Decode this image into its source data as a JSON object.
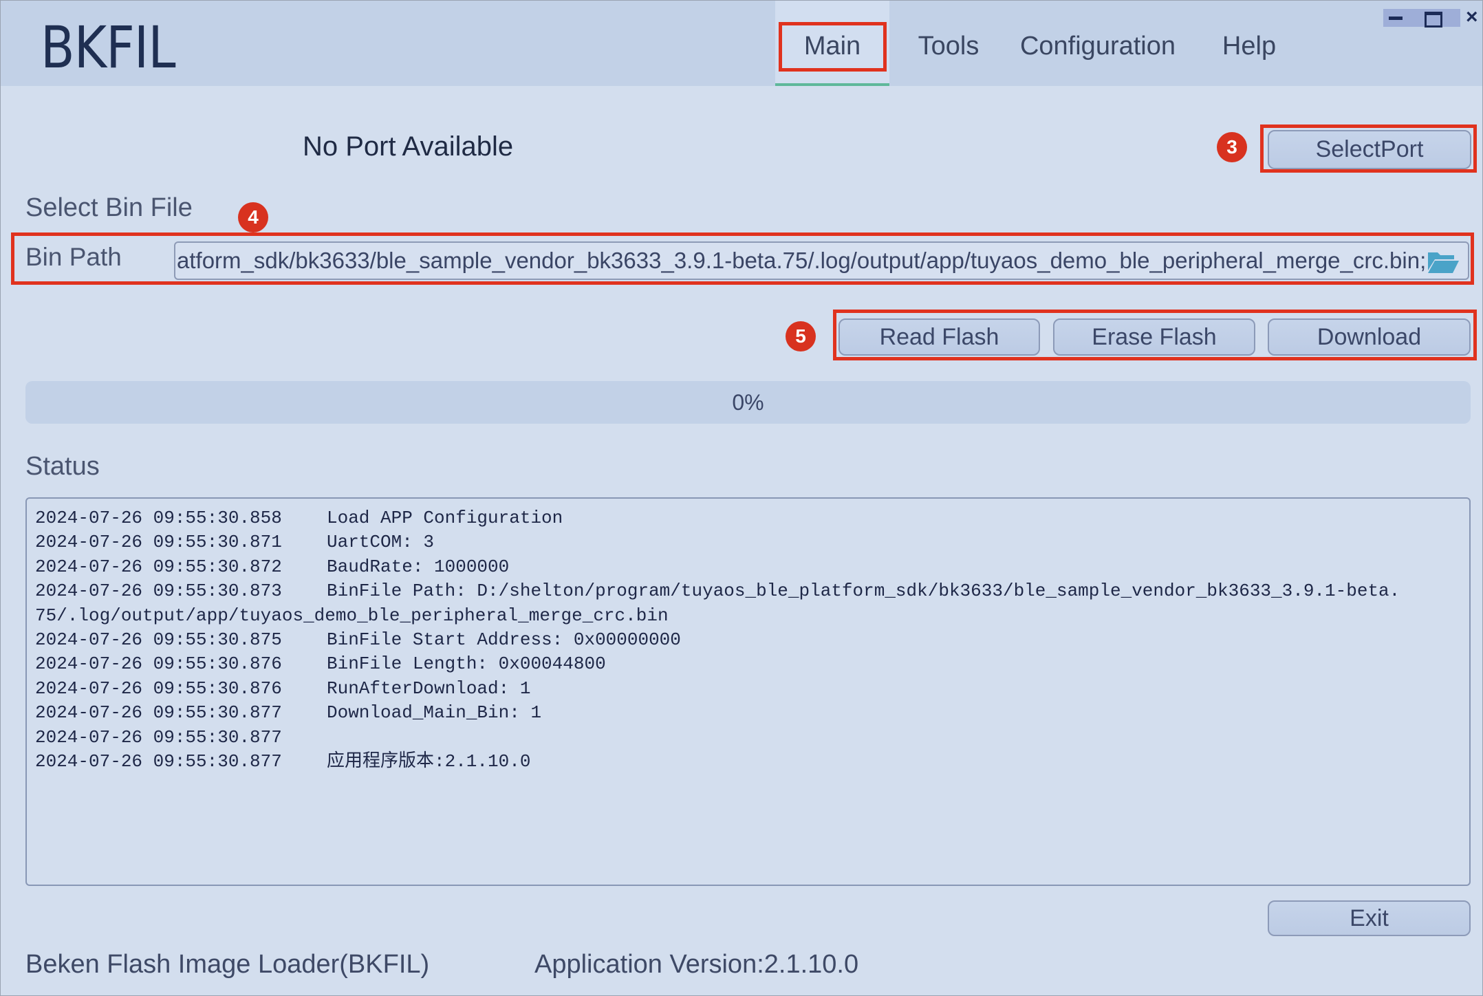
{
  "app": {
    "title": "BKFIL",
    "footer_name": "Beken Flash Image Loader(BKFIL)",
    "footer_version": "Application Version:2.1.10.0"
  },
  "tabs": [
    {
      "label": "Main",
      "active": true
    },
    {
      "label": "Tools",
      "active": false
    },
    {
      "label": "Configuration",
      "active": false
    },
    {
      "label": "Help",
      "active": false
    }
  ],
  "window_controls": {
    "minimize": "minimize-icon",
    "maximize": "maximize-icon",
    "close": "×"
  },
  "port": {
    "status": "No Port Available",
    "select_button": "SelectPort"
  },
  "bin_file": {
    "section_label": "Select Bin File",
    "field_label": "Bin Path",
    "value": "atform_sdk/bk3633/ble_sample_vendor_bk3633_3.9.1-beta.75/.log/output/app/tuyaos_demo_ble_peripheral_merge_crc.bin;",
    "browse_icon": "folder-open-icon"
  },
  "actions": {
    "read_flash": "Read Flash",
    "erase_flash": "Erase Flash",
    "download": "Download"
  },
  "progress": {
    "percent": 0,
    "label": "0%"
  },
  "status": {
    "label": "Status",
    "log": [
      {
        "time": "2024-07-26 09:55:30.858",
        "msg": "Load APP Configuration"
      },
      {
        "time": "2024-07-26 09:55:30.871",
        "msg": "UartCOM: 3"
      },
      {
        "time": "2024-07-26 09:55:30.872",
        "msg": "BaudRate: 1000000"
      },
      {
        "time": "2024-07-26 09:55:30.873",
        "msg": "BinFile Path: D:/shelton/program/tuyaos_ble_platform_sdk/bk3633/ble_sample_vendor_bk3633_3.9.1-beta."
      },
      {
        "time": "",
        "msg": "75/.log/output/app/tuyaos_demo_ble_peripheral_merge_crc.bin",
        "continuation": true
      },
      {
        "time": "2024-07-26 09:55:30.875",
        "msg": "BinFile Start Address: 0x00000000"
      },
      {
        "time": "2024-07-26 09:55:30.876",
        "msg": "BinFile Length: 0x00044800"
      },
      {
        "time": "2024-07-26 09:55:30.876",
        "msg": "RunAfterDownload: 1"
      },
      {
        "time": "2024-07-26 09:55:30.877",
        "msg": "Download_Main_Bin: 1"
      },
      {
        "time": "2024-07-26 09:55:30.877",
        "msg": ""
      },
      {
        "time": "2024-07-26 09:55:30.877",
        "msg": "应用程序版本:2.1.10.0"
      }
    ]
  },
  "exit_button": "Exit",
  "annotations": {
    "badge_3": "3",
    "badge_4": "4",
    "badge_5": "5",
    "highlight_color": "#e0321e"
  },
  "colors": {
    "background": "#d3deee",
    "header": "#c2d1e7",
    "tab_underline": "#5fb89a",
    "folder_icon": "#4aa3c8"
  }
}
